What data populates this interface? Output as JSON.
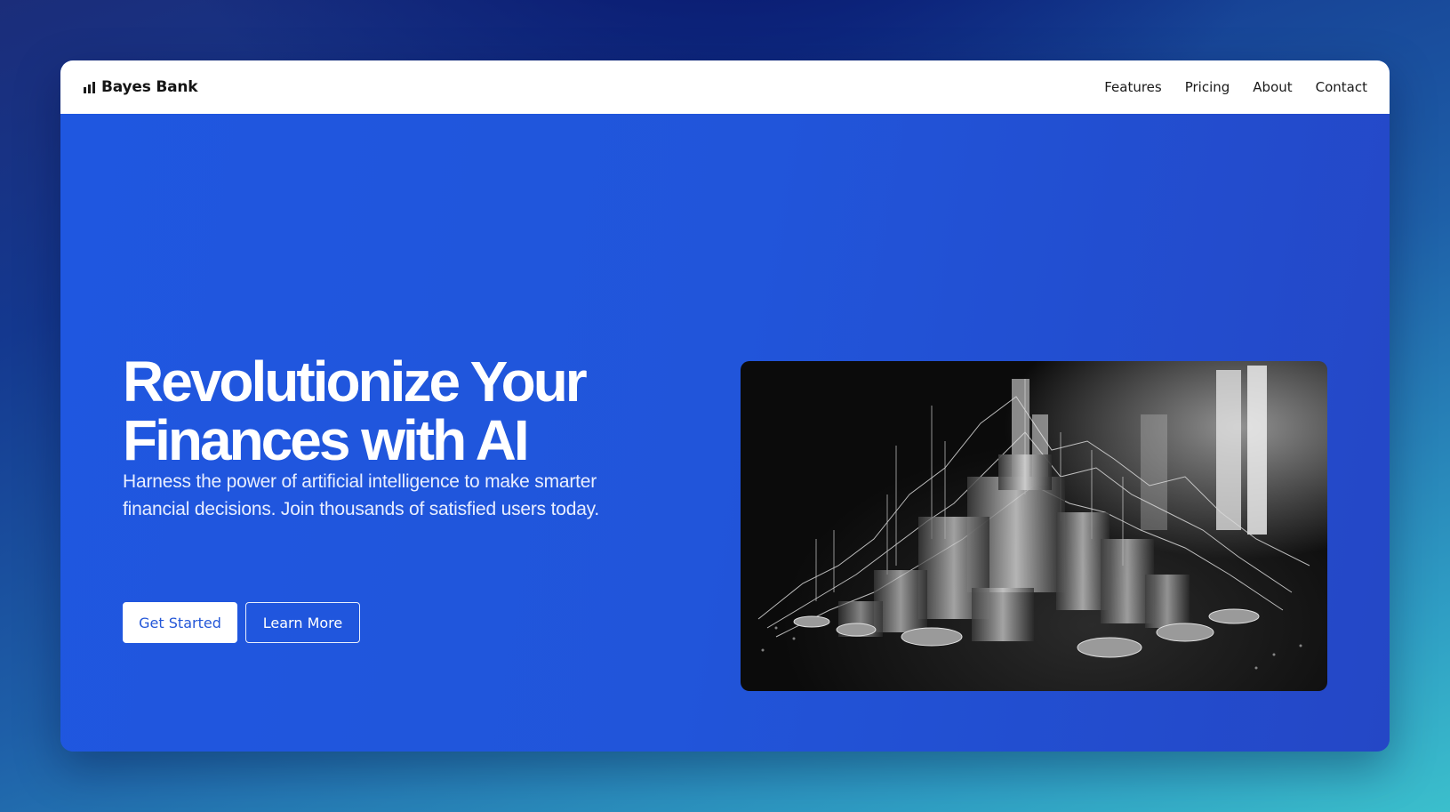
{
  "brand": {
    "name": "Bayes Bank",
    "icon": "bar-chart-icon"
  },
  "nav": {
    "links": [
      "Features",
      "Pricing",
      "About",
      "Contact"
    ]
  },
  "hero": {
    "title": "Revolutionize Your Finances with AI",
    "subtitle": "Harness the power of artificial intelligence to make smarter financial decisions. Join thousands of satisfied users today.",
    "primary_button": "Get Started",
    "secondary_button": "Learn More",
    "image": "coin-stacks-chart-illustration"
  },
  "colors": {
    "hero_background": "#2358e0",
    "primary_button_text": "#2457d8",
    "navbar_background": "#ffffff"
  }
}
